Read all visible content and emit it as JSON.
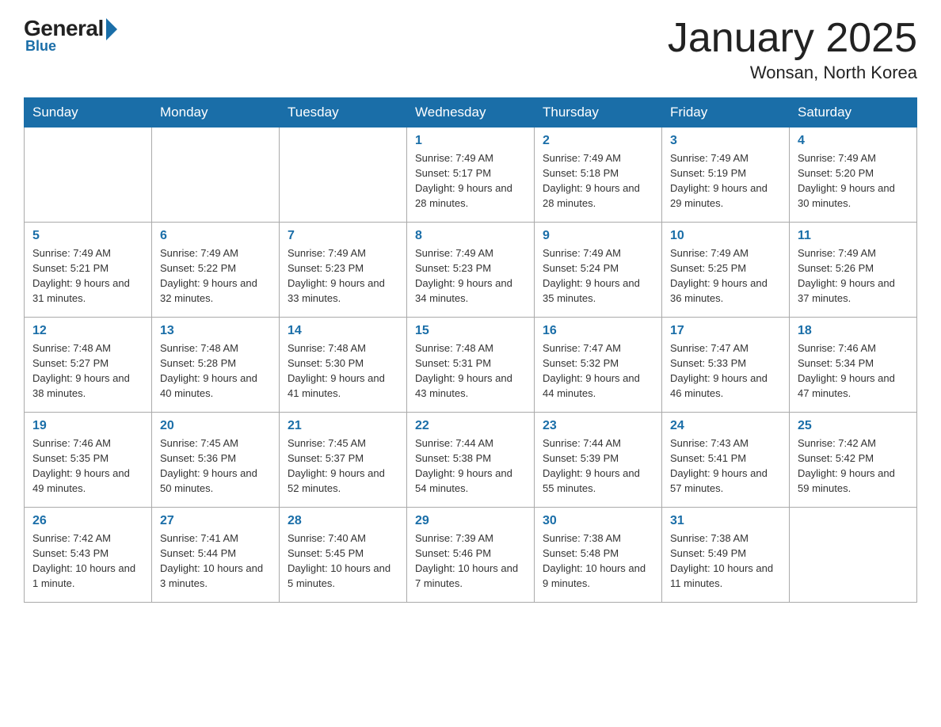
{
  "header": {
    "logo_general": "General",
    "logo_blue": "Blue",
    "month_title": "January 2025",
    "location": "Wonsan, North Korea"
  },
  "days_of_week": [
    "Sunday",
    "Monday",
    "Tuesday",
    "Wednesday",
    "Thursday",
    "Friday",
    "Saturday"
  ],
  "weeks": [
    [
      {
        "day": "",
        "info": ""
      },
      {
        "day": "",
        "info": ""
      },
      {
        "day": "",
        "info": ""
      },
      {
        "day": "1",
        "info": "Sunrise: 7:49 AM\nSunset: 5:17 PM\nDaylight: 9 hours and 28 minutes."
      },
      {
        "day": "2",
        "info": "Sunrise: 7:49 AM\nSunset: 5:18 PM\nDaylight: 9 hours and 28 minutes."
      },
      {
        "day": "3",
        "info": "Sunrise: 7:49 AM\nSunset: 5:19 PM\nDaylight: 9 hours and 29 minutes."
      },
      {
        "day": "4",
        "info": "Sunrise: 7:49 AM\nSunset: 5:20 PM\nDaylight: 9 hours and 30 minutes."
      }
    ],
    [
      {
        "day": "5",
        "info": "Sunrise: 7:49 AM\nSunset: 5:21 PM\nDaylight: 9 hours and 31 minutes."
      },
      {
        "day": "6",
        "info": "Sunrise: 7:49 AM\nSunset: 5:22 PM\nDaylight: 9 hours and 32 minutes."
      },
      {
        "day": "7",
        "info": "Sunrise: 7:49 AM\nSunset: 5:23 PM\nDaylight: 9 hours and 33 minutes."
      },
      {
        "day": "8",
        "info": "Sunrise: 7:49 AM\nSunset: 5:23 PM\nDaylight: 9 hours and 34 minutes."
      },
      {
        "day": "9",
        "info": "Sunrise: 7:49 AM\nSunset: 5:24 PM\nDaylight: 9 hours and 35 minutes."
      },
      {
        "day": "10",
        "info": "Sunrise: 7:49 AM\nSunset: 5:25 PM\nDaylight: 9 hours and 36 minutes."
      },
      {
        "day": "11",
        "info": "Sunrise: 7:49 AM\nSunset: 5:26 PM\nDaylight: 9 hours and 37 minutes."
      }
    ],
    [
      {
        "day": "12",
        "info": "Sunrise: 7:48 AM\nSunset: 5:27 PM\nDaylight: 9 hours and 38 minutes."
      },
      {
        "day": "13",
        "info": "Sunrise: 7:48 AM\nSunset: 5:28 PM\nDaylight: 9 hours and 40 minutes."
      },
      {
        "day": "14",
        "info": "Sunrise: 7:48 AM\nSunset: 5:30 PM\nDaylight: 9 hours and 41 minutes."
      },
      {
        "day": "15",
        "info": "Sunrise: 7:48 AM\nSunset: 5:31 PM\nDaylight: 9 hours and 43 minutes."
      },
      {
        "day": "16",
        "info": "Sunrise: 7:47 AM\nSunset: 5:32 PM\nDaylight: 9 hours and 44 minutes."
      },
      {
        "day": "17",
        "info": "Sunrise: 7:47 AM\nSunset: 5:33 PM\nDaylight: 9 hours and 46 minutes."
      },
      {
        "day": "18",
        "info": "Sunrise: 7:46 AM\nSunset: 5:34 PM\nDaylight: 9 hours and 47 minutes."
      }
    ],
    [
      {
        "day": "19",
        "info": "Sunrise: 7:46 AM\nSunset: 5:35 PM\nDaylight: 9 hours and 49 minutes."
      },
      {
        "day": "20",
        "info": "Sunrise: 7:45 AM\nSunset: 5:36 PM\nDaylight: 9 hours and 50 minutes."
      },
      {
        "day": "21",
        "info": "Sunrise: 7:45 AM\nSunset: 5:37 PM\nDaylight: 9 hours and 52 minutes."
      },
      {
        "day": "22",
        "info": "Sunrise: 7:44 AM\nSunset: 5:38 PM\nDaylight: 9 hours and 54 minutes."
      },
      {
        "day": "23",
        "info": "Sunrise: 7:44 AM\nSunset: 5:39 PM\nDaylight: 9 hours and 55 minutes."
      },
      {
        "day": "24",
        "info": "Sunrise: 7:43 AM\nSunset: 5:41 PM\nDaylight: 9 hours and 57 minutes."
      },
      {
        "day": "25",
        "info": "Sunrise: 7:42 AM\nSunset: 5:42 PM\nDaylight: 9 hours and 59 minutes."
      }
    ],
    [
      {
        "day": "26",
        "info": "Sunrise: 7:42 AM\nSunset: 5:43 PM\nDaylight: 10 hours and 1 minute."
      },
      {
        "day": "27",
        "info": "Sunrise: 7:41 AM\nSunset: 5:44 PM\nDaylight: 10 hours and 3 minutes."
      },
      {
        "day": "28",
        "info": "Sunrise: 7:40 AM\nSunset: 5:45 PM\nDaylight: 10 hours and 5 minutes."
      },
      {
        "day": "29",
        "info": "Sunrise: 7:39 AM\nSunset: 5:46 PM\nDaylight: 10 hours and 7 minutes."
      },
      {
        "day": "30",
        "info": "Sunrise: 7:38 AM\nSunset: 5:48 PM\nDaylight: 10 hours and 9 minutes."
      },
      {
        "day": "31",
        "info": "Sunrise: 7:38 AM\nSunset: 5:49 PM\nDaylight: 10 hours and 11 minutes."
      },
      {
        "day": "",
        "info": ""
      }
    ]
  ]
}
